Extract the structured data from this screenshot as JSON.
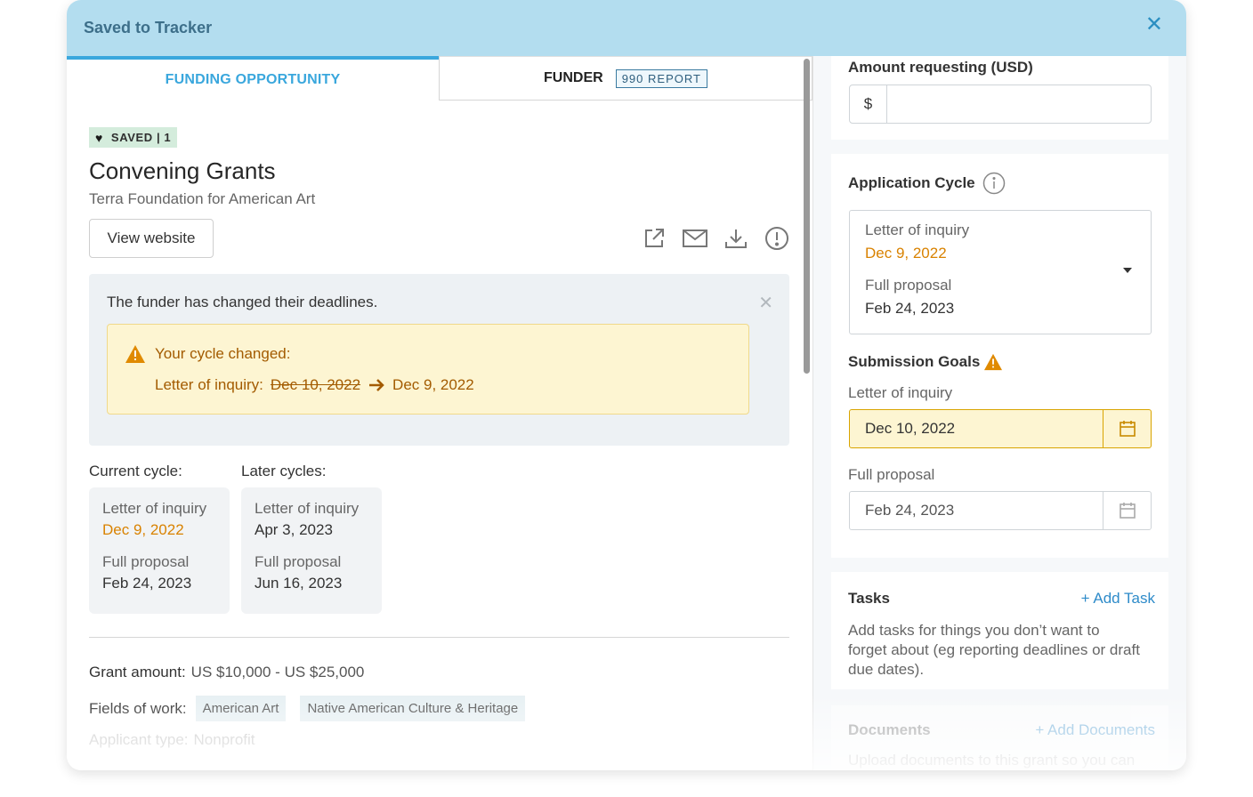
{
  "header": {
    "title": "Saved to Tracker",
    "close_icon": "close-icon"
  },
  "tabs": {
    "funding": "FUNDING OPPORTUNITY",
    "funder": "FUNDER",
    "report_badge": "990 REPORT"
  },
  "grant": {
    "saved_badge": "SAVED | 1",
    "title": "Convening Grants",
    "organization": "Terra Foundation for American Art",
    "view_website": "View website"
  },
  "notice": {
    "message": "The funder has changed their deadlines.",
    "cycle_changed": "Your cycle changed:",
    "change_label": "Letter of inquiry:",
    "old_date": "Dec 10, 2022",
    "new_date": "Dec 9, 2022"
  },
  "cycles": {
    "current_label": "Current cycle:",
    "later_label": "Later cycles:",
    "current": [
      {
        "label": "Letter of inquiry",
        "date": "Dec 9, 2022"
      },
      {
        "label": "Full proposal",
        "date": "Feb 24, 2023"
      }
    ],
    "later": [
      {
        "label": "Letter of inquiry",
        "date": "Apr 3, 2023"
      },
      {
        "label": "Full proposal",
        "date": "Jun 16, 2023"
      }
    ]
  },
  "details": {
    "grant_amount_label": "Grant amount:",
    "grant_amount_value": "US $10,000 - US $25,000",
    "fields_label": "Fields of work:",
    "fields": [
      "American Art",
      "Native American Culture & Heritage"
    ],
    "applicant_label": "Applicant type:",
    "applicant_value": "Nonprofit"
  },
  "right": {
    "amount_label": "Amount requesting (USD)",
    "currency": "$",
    "amount_value": "",
    "app_cycle_title": "Application Cycle",
    "app_cycle": [
      {
        "label": "Letter of inquiry",
        "date": "Dec 9, 2022"
      },
      {
        "label": "Full proposal",
        "date": "Feb 24, 2023"
      }
    ],
    "submission_goals_title": "Submission Goals",
    "goal1_label": "Letter of inquiry",
    "goal1_date": "Dec 10, 2022",
    "goal2_label": "Full proposal",
    "goal2_date": "Feb 24, 2023",
    "tasks_title": "Tasks",
    "add_task": "+ Add Task",
    "tasks_help": "Add tasks for things you don’t want to forget about (eg reporting deadlines or draft due dates).",
    "documents_title": "Documents",
    "add_documents": "+ Add Documents",
    "documents_help": "Upload documents to this grant so you can"
  },
  "colors": {
    "header_bg": "#b3ddef",
    "accent_blue": "#3aa7dd",
    "warning_orange": "#d98200",
    "warning_bg": "#fdf5d2"
  }
}
